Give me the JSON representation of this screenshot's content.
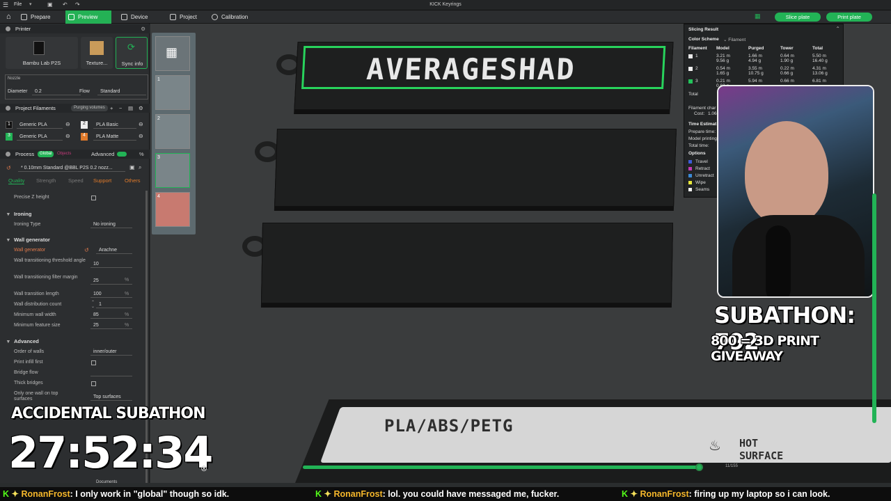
{
  "window": {
    "title": "KICK Keyrings",
    "file_menu": "File"
  },
  "nav": {
    "tabs": [
      {
        "label": "Prepare"
      },
      {
        "label": "Preview"
      },
      {
        "label": "Device"
      },
      {
        "label": "Project"
      },
      {
        "label": "Calibration"
      }
    ],
    "slice_plate": "Slice plate",
    "print_plate": "Print plate"
  },
  "printer": {
    "section": "Printer",
    "name": "Bambu Lab P2S",
    "plate": "Texture...",
    "sync": "Sync info",
    "nozzle_label": "Nozzle",
    "diameter_label": "Diameter",
    "diameter_value": "0.2",
    "flow_label": "Flow",
    "flow_value": "Standard"
  },
  "filaments": {
    "section": "Project Filaments",
    "purging_button": "Purging volumes",
    "items": [
      {
        "num": "1",
        "name": "Generic PLA"
      },
      {
        "num": "2",
        "name": "PLA Basic"
      },
      {
        "num": "3",
        "name": "Generic PLA"
      },
      {
        "num": "4",
        "name": "PLA Matte"
      }
    ]
  },
  "process": {
    "section": "Process",
    "global": "Global",
    "objects": "Objects",
    "advanced": "Advanced",
    "preset": "* 0.10mm Standard @BBL P2S 0.2 nozz...",
    "tabs": [
      "Quality",
      "Strength",
      "Speed",
      "Support",
      "Others"
    ],
    "precise_z": "Precise Z height",
    "ironing_group": "Ironing",
    "ironing_type_label": "Ironing Type",
    "ironing_type_value": "No ironing",
    "wall_group": "Wall generator",
    "wall_generator_label": "Wall generator",
    "wall_generator_value": "Arachne",
    "wall_threshold_label": "Wall transitioning threshold angle",
    "wall_threshold_value": "10",
    "wall_filter_label": "Wall transitioning filter margin",
    "wall_filter_value": "25",
    "wall_length_label": "Wall transition length",
    "wall_length_value": "100",
    "wall_dist_label": "Wall distribution count",
    "wall_dist_value": "1",
    "min_wall_label": "Minimum wall width",
    "min_wall_value": "85",
    "min_feature_label": "Minimum feature size",
    "min_feature_value": "25",
    "advanced_group": "Advanced",
    "order_walls_label": "Order of walls",
    "order_walls_value": "inner/outer",
    "infill_first": "Print infill first",
    "bridge_flow_label": "Bridge flow",
    "thick_bridges": "Thick bridges",
    "one_wall_label": "Only one wall on top surfaces",
    "one_wall_value": "Top surfaces",
    "unit_pct": "%",
    "unit_mm": "%"
  },
  "plates": [
    "1",
    "2",
    "3",
    "4"
  ],
  "keychain": {
    "text": "AVERAGESHAD"
  },
  "bed": {
    "label": "PLA/ABS/PETG",
    "hot": "HOT",
    "surface": "SURFACE"
  },
  "slicing": {
    "title": "Slicing Result",
    "color_scheme_label": "Color Scheme",
    "color_scheme_value": "Filament",
    "headers": [
      "Filament",
      "Model",
      "Purged",
      "Tower",
      "Total"
    ],
    "rows": [
      {
        "num": "1",
        "model": "3.21 m\n9.56 g",
        "purged": "1.66 m\n4.94 g",
        "tower": "0.64 m\n1.90 g",
        "total": "5.50 m\n16.40 g",
        "color": "#e8e8e8"
      },
      {
        "num": "2",
        "model": "0.54 m\n1.65 g",
        "purged": "3.55 m\n10.75 g",
        "tower": "0.22 m\n0.66 g",
        "total": "4.31 m\n13.06 g",
        "color": "#f0f0f0"
      },
      {
        "num": "3",
        "model": "0.21 m\n0.62 g",
        "purged": "5.94 m",
        "tower": "0.66 m",
        "total": "6.81 m",
        "color": "#22c35a"
      }
    ],
    "total_label": "Total",
    "filament_change": "Filament char",
    "cost_label": "Cost:",
    "cost_value": "1.06",
    "time_estimation": "Time Estimat",
    "prepare_time": "Prepare time:",
    "model_printing": "Model printing",
    "total_time": "Total time:",
    "options": "Options",
    "option_items": [
      {
        "label": "Travel",
        "color": "#3d5bd8"
      },
      {
        "label": "Retract",
        "color": "#c43ab4"
      },
      {
        "label": "Unretract",
        "color": "#3c8ad6"
      },
      {
        "label": "Wipe",
        "color": "#e8e83a"
      },
      {
        "label": "Seams",
        "color": "#f0f0f0"
      }
    ]
  },
  "overlay": {
    "subathon": "SUBATHON: 792",
    "giveaway": "800 = 3D PRINT GIVEAWAY",
    "accidental": "ACCIDENTAL SUBATHON",
    "timer": "27:52:34",
    "progress_value": "11/155",
    "progress_fraction": 0.95
  },
  "taskbar": {
    "documents": "Documents"
  },
  "ticker": [
    {
      "name": "RonanFrost",
      "msg": "I only work in \"global\" though so idk."
    },
    {
      "name": "RonanFrost",
      "msg": "lol. you could have messaged me, fucker."
    },
    {
      "name": "RonanFrost",
      "msg": "firing up my laptop so i can look."
    }
  ],
  "colors": {
    "accent": "#22b356",
    "kick": "#53fc18",
    "name": "#f5b72b"
  }
}
